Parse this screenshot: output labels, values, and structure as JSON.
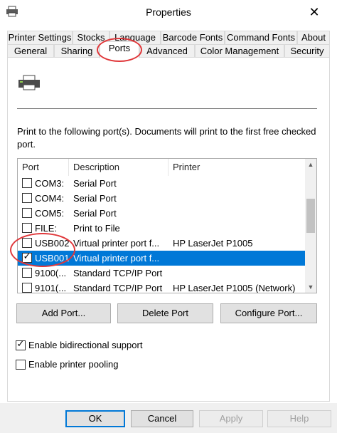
{
  "window": {
    "title": "Properties",
    "close_glyph": "✕"
  },
  "tabs_row1": [
    {
      "label": "Printer Settings"
    },
    {
      "label": "Stocks"
    },
    {
      "label": "Language"
    },
    {
      "label": "Barcode Fonts"
    },
    {
      "label": "Command Fonts"
    },
    {
      "label": "About"
    }
  ],
  "tabs_row2": [
    {
      "label": "General"
    },
    {
      "label": "Sharing"
    },
    {
      "label": "Ports",
      "selected": true
    },
    {
      "label": "Advanced"
    },
    {
      "label": "Color Management"
    },
    {
      "label": "Security"
    }
  ],
  "ports": {
    "instructions": "Print to the following port(s). Documents will print to the first free checked port.",
    "columns": {
      "port": "Port",
      "description": "Description",
      "printer": "Printer"
    },
    "rows": [
      {
        "port": "COM3:",
        "description": "Serial Port",
        "printer": "",
        "checked": false,
        "selected": false
      },
      {
        "port": "COM4:",
        "description": "Serial Port",
        "printer": "",
        "checked": false,
        "selected": false
      },
      {
        "port": "COM5:",
        "description": "Serial Port",
        "printer": "",
        "checked": false,
        "selected": false
      },
      {
        "port": "FILE:",
        "description": "Print to File",
        "printer": "",
        "checked": false,
        "selected": false
      },
      {
        "port": "USB002",
        "description": "Virtual printer port f...",
        "printer": "HP LaserJet P1005",
        "checked": false,
        "selected": false
      },
      {
        "port": "USB001",
        "description": "Virtual printer port f...",
        "printer": "",
        "checked": true,
        "selected": true
      },
      {
        "port": "9100(...",
        "description": "Standard TCP/IP Port",
        "printer": "",
        "checked": false,
        "selected": false
      },
      {
        "port": "9101(...",
        "description": "Standard TCP/IP Port",
        "printer": "HP LaserJet P1005 (Network)",
        "checked": false,
        "selected": false
      }
    ],
    "buttons": {
      "add": "Add Port...",
      "delete": "Delete Port",
      "configure": "Configure Port..."
    },
    "bidirectional": {
      "label": "Enable bidirectional support",
      "checked": true
    },
    "pooling": {
      "label": "Enable printer pooling",
      "checked": false
    }
  },
  "footer": {
    "ok": "OK",
    "cancel": "Cancel",
    "apply": "Apply",
    "help": "Help"
  },
  "icons": {
    "scroll_up": "▲",
    "scroll_down": "▼",
    "check": "✓"
  },
  "colors": {
    "selection": "#0078d7",
    "annotation": "#e0373a"
  }
}
